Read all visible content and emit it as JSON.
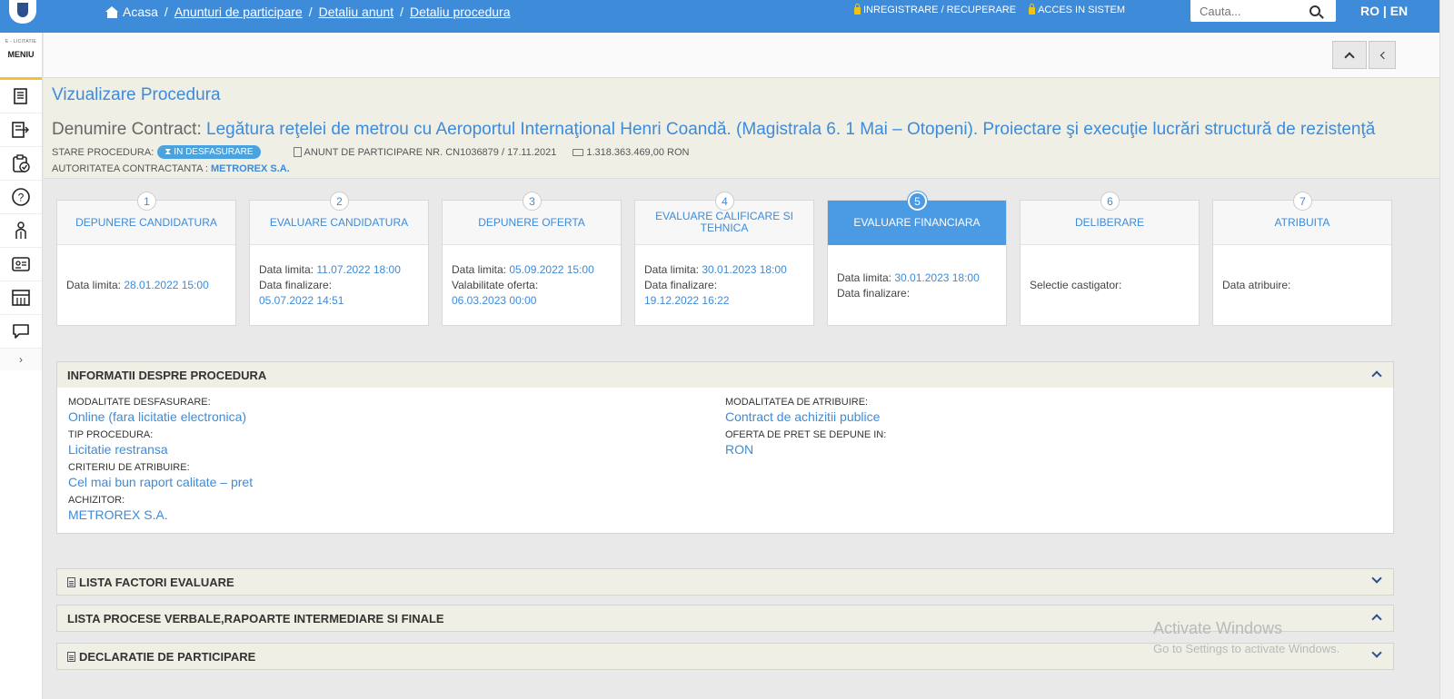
{
  "topbar": {
    "breadcrumb": [
      {
        "label": "Acasa"
      },
      {
        "label": "Anunturi de participare"
      },
      {
        "label": "Detaliu anunt"
      },
      {
        "label": "Detaliu procedura"
      }
    ],
    "register_label": "INREGISTRARE / RECUPERARE",
    "login_label": "ACCES IN SISTEM",
    "search_placeholder": "Cauta...",
    "language": "RO | EN"
  },
  "sidebar": {
    "brand_small": "E - LICITATIE",
    "menu_label": "MENIU",
    "items": [
      {
        "icon": "document-list-icon"
      },
      {
        "icon": "export-list-icon"
      },
      {
        "icon": "clipboard-check-icon"
      },
      {
        "icon": "help-icon"
      },
      {
        "icon": "person-icon"
      },
      {
        "icon": "id-card-icon"
      },
      {
        "icon": "catalog-icon"
      },
      {
        "icon": "chat-icon"
      }
    ],
    "expand_label": "›"
  },
  "header": {
    "page_title": "Vizualizare Procedura",
    "contract_label": "Denumire Contract:",
    "contract_name": "Legătura reţelei de metrou cu Aeroportul Internaţional Henri Coandă. (Magistrala 6. 1 Mai – Otopeni). Proiectare şi execuţie lucrări structură de rezistenţă",
    "state_label": "STARE PROCEDURA:",
    "state_value": "IN DESFASURARE",
    "notice": "ANUNT DE PARTICIPARE NR. CN1036879 / 17.11.2021",
    "value": "1.318.363.469,00  RON",
    "authority_label": "AUTORITATEA CONTRACTANTA :",
    "authority_value": "METROREX S.A."
  },
  "steps": [
    {
      "num": "1",
      "title": "DEPUNERE CANDIDATURA",
      "lines": [
        {
          "label": "Data limita: ",
          "value": "28.01.2022 15:00"
        }
      ]
    },
    {
      "num": "2",
      "title": "EVALUARE CANDIDATURA",
      "lines": [
        {
          "label": "Data limita: ",
          "value": "11.07.2022 18:00"
        },
        {
          "label": "Data finalizare:",
          "value": ""
        },
        {
          "label": "",
          "value": "05.07.2022 14:51"
        }
      ]
    },
    {
      "num": "3",
      "title": "DEPUNERE OFERTA",
      "lines": [
        {
          "label": "Data limita: ",
          "value": "05.09.2022 15:00"
        },
        {
          "label": "Valabilitate oferta:",
          "value": ""
        },
        {
          "label": "",
          "value": "06.03.2023 00:00"
        }
      ]
    },
    {
      "num": "4",
      "title": "EVALUARE CALIFICARE SI TEHNICA",
      "lines": [
        {
          "label": "Data limita: ",
          "value": "30.01.2023 18:00"
        },
        {
          "label": "Data finalizare:",
          "value": ""
        },
        {
          "label": "",
          "value": "19.12.2022 16:22"
        }
      ]
    },
    {
      "num": "5",
      "title": "EVALUARE FINANCIARA",
      "active": true,
      "lines": [
        {
          "label": "Data limita: ",
          "value": "30.01.2023 18:00"
        },
        {
          "label": "Data finalizare:",
          "value": ""
        }
      ]
    },
    {
      "num": "6",
      "title": "DELIBERARE",
      "lines": [
        {
          "label": "Selectie castigator:",
          "value": ""
        }
      ]
    },
    {
      "num": "7",
      "title": "ATRIBUITA",
      "lines": [
        {
          "label": "Data atribuire:",
          "value": ""
        }
      ]
    }
  ],
  "info_panel": {
    "title": "INFORMATII DESPRE PROCEDURA",
    "left": [
      {
        "label": "MODALITATE DESFASURARE:",
        "value": "Online (fara licitatie electronica)"
      },
      {
        "label": "TIP PROCEDURA:",
        "value": "Licitatie restransa"
      },
      {
        "label": "CRITERIU DE ATRIBUIRE:",
        "value": "Cel mai bun raport calitate – pret"
      },
      {
        "label": "ACHIZITOR:",
        "value": "METROREX S.A."
      }
    ],
    "right": [
      {
        "label": "MODALITATEA DE ATRIBUIRE:",
        "value": "Contract de achizitii publice"
      },
      {
        "label": "OFERTA DE PRET SE DEPUNE IN:",
        "value": "RON"
      }
    ]
  },
  "collapsed_panels": [
    {
      "title": "LISTA FACTORI EVALUARE",
      "icon": true,
      "chevron": "down"
    },
    {
      "title": "LISTA PROCESE VERBALE,RAPOARTE INTERMEDIARE SI FINALE",
      "icon": false,
      "chevron": "up"
    },
    {
      "title": "DECLARATIE DE PARTICIPARE",
      "icon": true,
      "chevron": "down"
    }
  ],
  "watermark": {
    "line1": "Activate Windows",
    "line2": "Go to Settings to activate Windows."
  }
}
